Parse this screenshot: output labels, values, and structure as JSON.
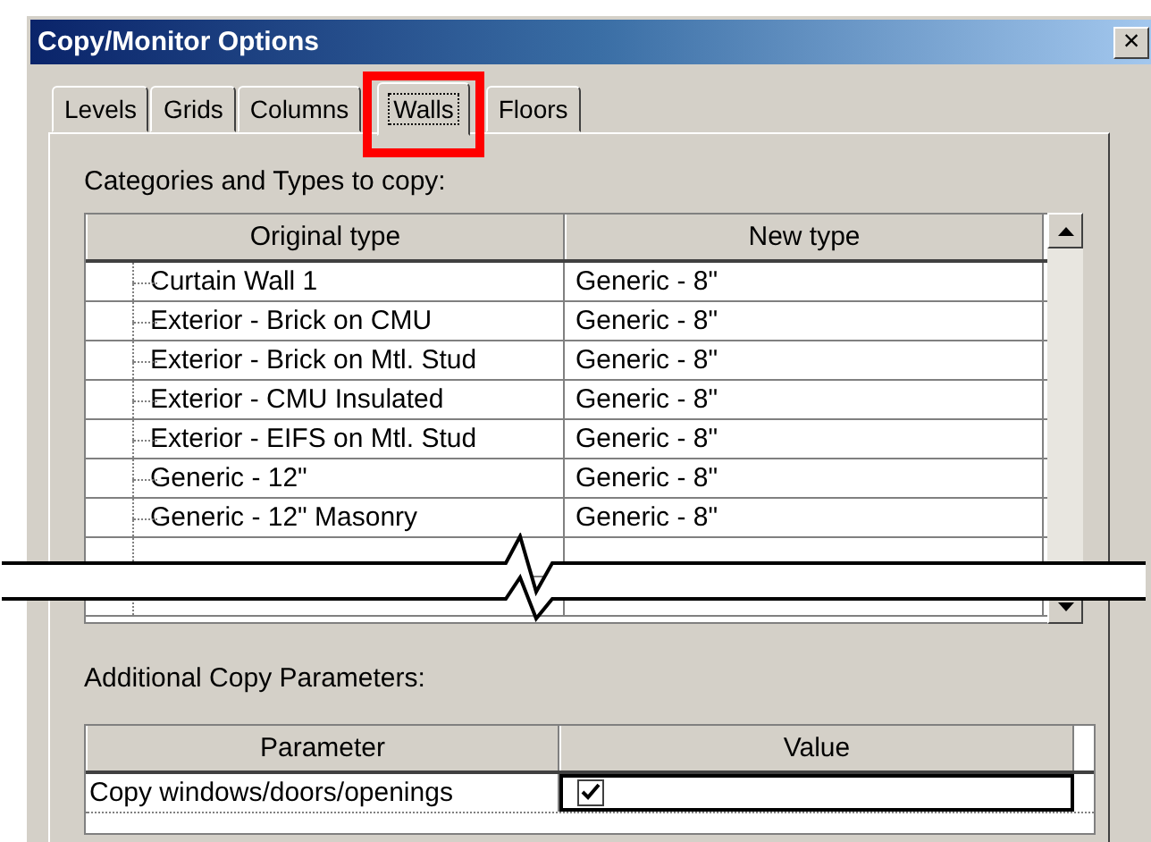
{
  "window": {
    "title": "Copy/Monitor Options",
    "close": "×"
  },
  "tabs": [
    {
      "label": "Levels",
      "selected": false
    },
    {
      "label": "Grids",
      "selected": false
    },
    {
      "label": "Columns",
      "selected": false
    },
    {
      "label": "Walls",
      "selected": true
    },
    {
      "label": "Floors",
      "selected": false
    }
  ],
  "types_section": {
    "label": "Categories and Types to copy:",
    "columns": [
      "Original type",
      "New type"
    ],
    "rows": [
      {
        "original": "Curtain Wall 1",
        "new": "Generic - 8\""
      },
      {
        "original": "Exterior - Brick on CMU",
        "new": "Generic - 8\""
      },
      {
        "original": "Exterior - Brick on Mtl. Stud",
        "new": "Generic - 8\""
      },
      {
        "original": "Exterior - CMU Insulated",
        "new": "Generic - 8\""
      },
      {
        "original": "Exterior - EIFS on Mtl. Stud",
        "new": "Generic - 8\""
      },
      {
        "original": "Generic - 12\"",
        "new": "Generic - 8\""
      },
      {
        "original": "Generic - 12\" Masonry",
        "new": "Generic - 8\""
      }
    ]
  },
  "parameters_section": {
    "label": "Additional Copy Parameters:",
    "columns": [
      "Parameter",
      "Value"
    ],
    "rows": [
      {
        "parameter": "Copy windows/doors/openings",
        "checked": true
      }
    ]
  }
}
